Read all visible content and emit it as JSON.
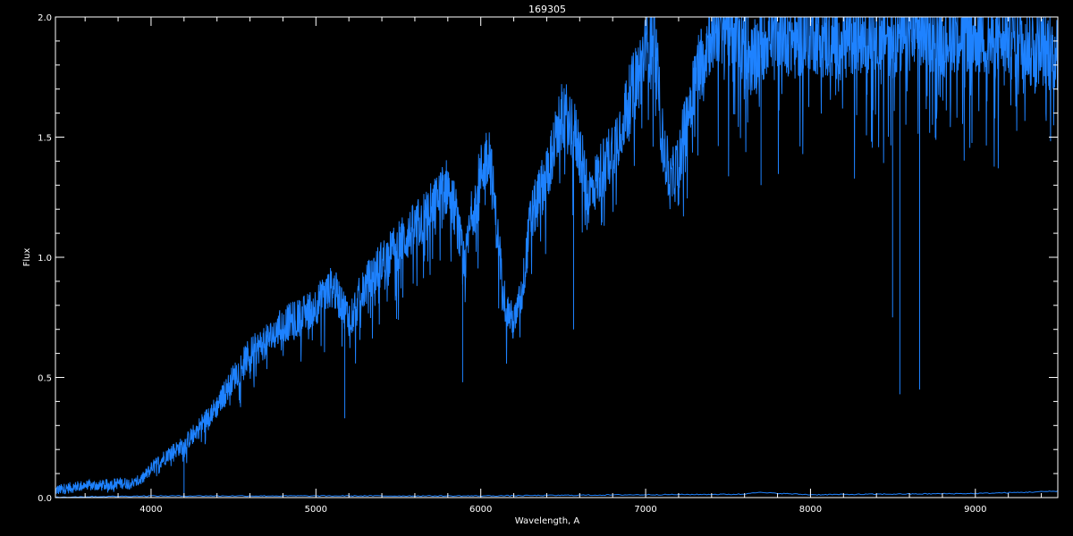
{
  "chart_data": {
    "type": "line",
    "title": "169305",
    "xlabel": "Wavelength, A",
    "ylabel": "Flux",
    "xlim": [
      3420,
      9500
    ],
    "ylim": [
      0,
      2.0
    ],
    "xticks": [
      4000,
      5000,
      6000,
      7000,
      8000,
      9000
    ],
    "yticks": [
      0.0,
      0.5,
      1.0,
      1.5,
      2.0
    ],
    "ytick_labels": [
      "0.0",
      "0.5",
      "1.0",
      "1.5",
      "2.0"
    ],
    "grid": false,
    "legend": "none",
    "colors": {
      "background": "#000000",
      "axes": "#ffffff",
      "spectrum": "#1e82ff",
      "error": "#1e82ff"
    },
    "series": [
      {
        "role": "spectrum",
        "x": [
          3420,
          3500,
          3600,
          3700,
          3800,
          3900,
          3950,
          4000,
          4100,
          4200,
          4300,
          4400,
          4500,
          4600,
          4700,
          4800,
          4900,
          5000,
          5100,
          5200,
          5300,
          5400,
          5500,
          5600,
          5700,
          5800,
          5850,
          5900,
          5950,
          6000,
          6050,
          6100,
          6150,
          6200,
          6250,
          6300,
          6400,
          6500,
          6550,
          6600,
          6650,
          6700,
          6800,
          6900,
          7000,
          7050,
          7100,
          7150,
          7200,
          7300,
          7400,
          7500,
          7600,
          7650,
          7700,
          7800,
          7900,
          8000,
          8100,
          8200,
          8300,
          8400,
          8500,
          8600,
          8700,
          8800,
          8900,
          9000,
          9100,
          9200,
          9300,
          9400,
          9500
        ],
        "y": [
          0.03,
          0.04,
          0.05,
          0.05,
          0.06,
          0.06,
          0.08,
          0.12,
          0.18,
          0.22,
          0.3,
          0.38,
          0.5,
          0.6,
          0.65,
          0.72,
          0.75,
          0.8,
          0.88,
          0.75,
          0.88,
          0.98,
          1.05,
          1.12,
          1.2,
          1.3,
          1.18,
          0.95,
          1.2,
          1.35,
          1.45,
          1.1,
          0.8,
          0.72,
          0.85,
          1.15,
          1.35,
          1.6,
          1.55,
          1.45,
          1.25,
          1.32,
          1.45,
          1.65,
          1.85,
          1.95,
          1.5,
          1.3,
          1.4,
          1.75,
          1.95,
          1.98,
          1.9,
          1.8,
          1.9,
          1.97,
          1.9,
          1.95,
          1.9,
          1.9,
          1.93,
          1.95,
          1.92,
          1.93,
          1.95,
          1.92,
          1.95,
          1.93,
          1.9,
          1.92,
          1.9,
          1.88,
          1.85
        ]
      },
      {
        "role": "error",
        "x": [
          3420,
          4000,
          5000,
          6000,
          7000,
          7600,
          7650,
          8000,
          9000,
          9300,
          9500
        ],
        "y": [
          0.0,
          0.005,
          0.005,
          0.005,
          0.01,
          0.012,
          0.02,
          0.01,
          0.015,
          0.02,
          0.025
        ]
      }
    ],
    "absorption_lines": [
      {
        "x": 4200,
        "y": 0.0
      },
      {
        "x": 5175,
        "y": 0.33
      },
      {
        "x": 5890,
        "y": 0.48
      },
      {
        "x": 6563,
        "y": 0.7
      },
      {
        "x": 7600,
        "y": 1.7
      },
      {
        "x": 7700,
        "y": 1.3
      },
      {
        "x": 8498,
        "y": 0.75
      },
      {
        "x": 8542,
        "y": 0.43
      },
      {
        "x": 8662,
        "y": 0.45
      }
    ]
  }
}
